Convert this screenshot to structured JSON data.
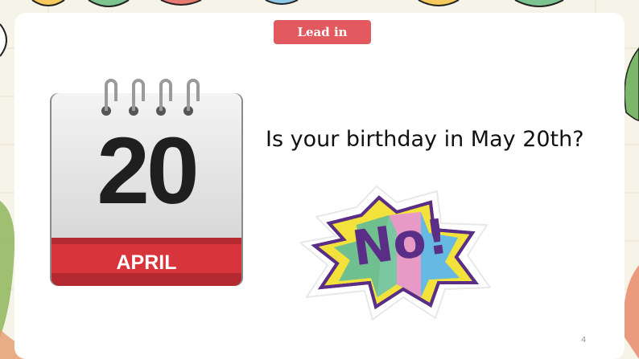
{
  "badge": {
    "label": "Lead in",
    "color": "#e25a5f"
  },
  "calendar": {
    "day": "20",
    "month": "APRIL",
    "icon": "calendar-icon"
  },
  "question": "Is your birthday in May 20th?",
  "sticker": {
    "text": "No!",
    "icon": "no-sticker-icon"
  },
  "page_number": "4"
}
